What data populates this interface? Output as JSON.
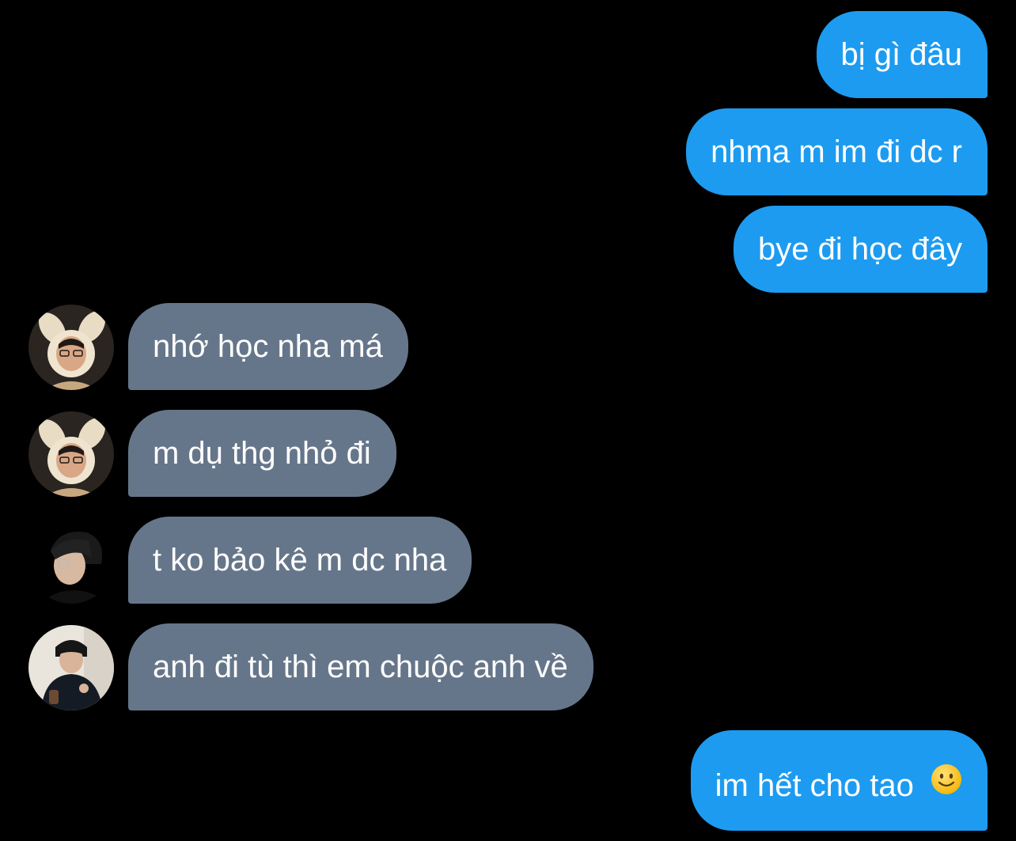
{
  "conversation": {
    "messages": [
      {
        "from": "me",
        "text": "bị gì đâu"
      },
      {
        "from": "me",
        "text": "nhma m im đi dc r"
      },
      {
        "from": "me",
        "text": "bye đi học đây"
      },
      {
        "from": "other",
        "avatar": "bunny-hat-avatar",
        "text": "nhớ học nha má"
      },
      {
        "from": "other",
        "avatar": "bunny-hat-avatar",
        "text": "m dụ thg nhỏ đi"
      },
      {
        "from": "other",
        "avatar": "profile-side-avatar",
        "text": "t ko bảo kê m dc nha"
      },
      {
        "from": "other",
        "avatar": "thumbs-up-avatar",
        "text": "anh đi tù thì em chuộc anh về"
      },
      {
        "from": "me",
        "text": "im hết cho tao",
        "emoji": "slightly-smiling-face-icon"
      }
    ]
  },
  "colors": {
    "background": "#000000",
    "sent_bubble": "#1d9bf0",
    "received_bubble": "#66768a",
    "text": "#ffffff"
  }
}
